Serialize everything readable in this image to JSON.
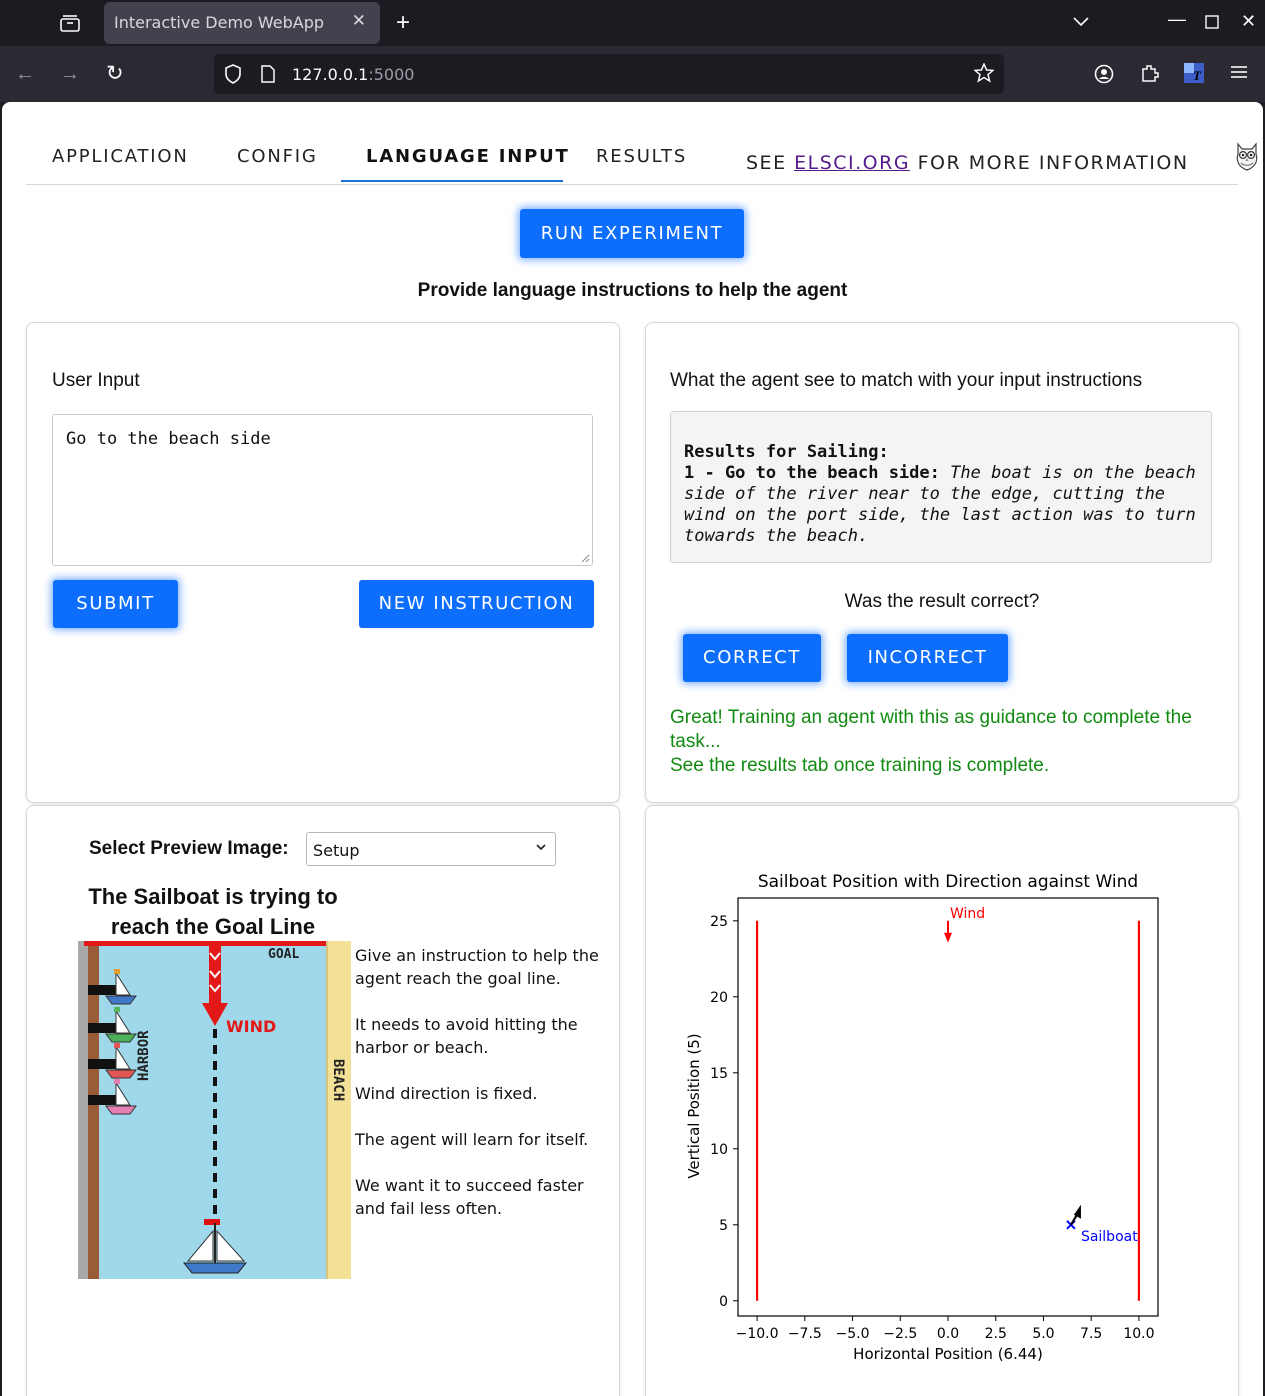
{
  "browser": {
    "tab_title": "Interactive Demo WebApp",
    "url_host": "127.0.0.1",
    "url_port": ":5000"
  },
  "nav": {
    "tabs": [
      "APPLICATION",
      "CONFIG",
      "LANGUAGE INPUT",
      "RESULTS"
    ],
    "active_tab": "LANGUAGE INPUT",
    "info_prefix": "SEE ",
    "info_link": "ELSCI.ORG",
    "info_suffix": " FOR MORE INFORMATION"
  },
  "run_button": "RUN EXPERIMENT",
  "heading": "Provide language instructions to help the agent",
  "user_input": {
    "label": "User Input",
    "value": "Go to the beach side",
    "submit": "SUBMIT",
    "new_instruction": "NEW INSTRUCTION"
  },
  "agent_view": {
    "label": "What the agent see to match with your input instructions",
    "results_header": "Results for Sailing:",
    "result_key": "1 - Go to the beach side:",
    "result_text": "The boat is on the beach side of the river near to the edge, cutting the wind on the port side, the last action was to turn towards the beach.",
    "question": "Was the result correct?",
    "correct": "CORRECT",
    "incorrect": "INCORRECT",
    "message_1": "Great! Training an agent with this as guidance to complete the task...",
    "message_2": "See the results tab once training is complete."
  },
  "preview": {
    "select_label": "Select Preview Image:",
    "selected": "Setup",
    "title": "The Sailboat is trying to reach the Goal Line",
    "image_labels": {
      "goal": "GOAL",
      "wind": "WIND",
      "harbor": "HARBOR",
      "beach": "BEACH"
    },
    "description": [
      "Give an instruction to help the agent reach the goal line.",
      "It needs to avoid hitting the harbor or beach.",
      "Wind direction is fixed.",
      "The agent will learn for itself.",
      "We want it to succeed faster and fail less often."
    ]
  },
  "chart_data": {
    "type": "scatter",
    "title": "Sailboat Position with Direction against Wind",
    "xlabel": "Horizontal Position (6.44)",
    "ylabel": "Vertical Position (5)",
    "xlim": [
      -11.0,
      11.0
    ],
    "ylim": [
      -1.0,
      26.5
    ],
    "xticks": [
      -10.0,
      -7.5,
      -5.0,
      -2.5,
      0.0,
      2.5,
      5.0,
      7.5,
      10.0
    ],
    "yticks": [
      0,
      5,
      10,
      15,
      20,
      25
    ],
    "boundaries": [
      {
        "x": -10,
        "y": [
          0,
          25
        ],
        "color": "#ff0000"
      },
      {
        "x": 10,
        "y": [
          0,
          25
        ],
        "color": "#ff0000"
      }
    ],
    "wind": {
      "x": 0,
      "y": 25,
      "label": "Wind",
      "color": "#ff0000"
    },
    "sailboat": {
      "x": 6.44,
      "y": 5,
      "label": "Sailboat",
      "color": "#0000ff"
    }
  }
}
